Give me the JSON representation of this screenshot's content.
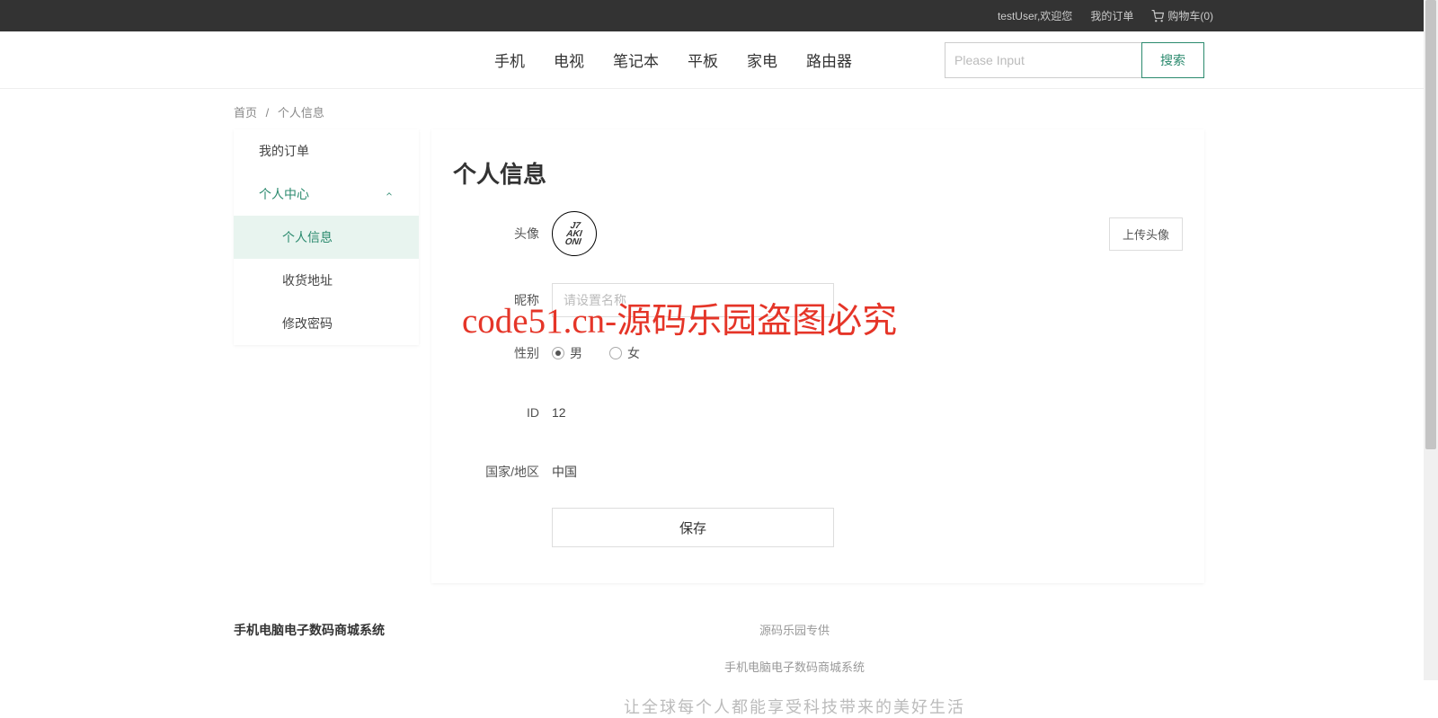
{
  "topbar": {
    "welcome": "testUser,欢迎您",
    "my_orders": "我的订单",
    "cart_label": "购物车(0)"
  },
  "nav": {
    "items": [
      "手机",
      "电视",
      "笔记本",
      "平板",
      "家电",
      "路由器"
    ],
    "search_placeholder": "Please Input",
    "search_btn": "搜索"
  },
  "breadcrumb": {
    "home": "首页",
    "current": "个人信息"
  },
  "sidebar": {
    "my_orders": "我的订单",
    "center": "个人中心",
    "subs": {
      "profile": "个人信息",
      "address": "收货地址",
      "password": "修改密码"
    }
  },
  "main": {
    "title": "个人信息",
    "labels": {
      "avatar": "头像",
      "nickname": "昵称",
      "gender": "性别",
      "id": "ID",
      "region": "国家/地区"
    },
    "upload_btn": "上传头像",
    "nickname_placeholder": "请设置名称",
    "gender_options": {
      "male": "男",
      "female": "女"
    },
    "gender_value": "male",
    "id_value": "12",
    "region_value": "中国",
    "save_btn": "保存"
  },
  "watermark": "code51.cn-源码乐园盗图必究",
  "footer": {
    "left": "手机电脑电子数码商城系统",
    "line1": "源码乐园专供",
    "line2": "手机电脑电子数码商城系统",
    "slogan": "让全球每个人都能享受科技带来的美好生活"
  }
}
